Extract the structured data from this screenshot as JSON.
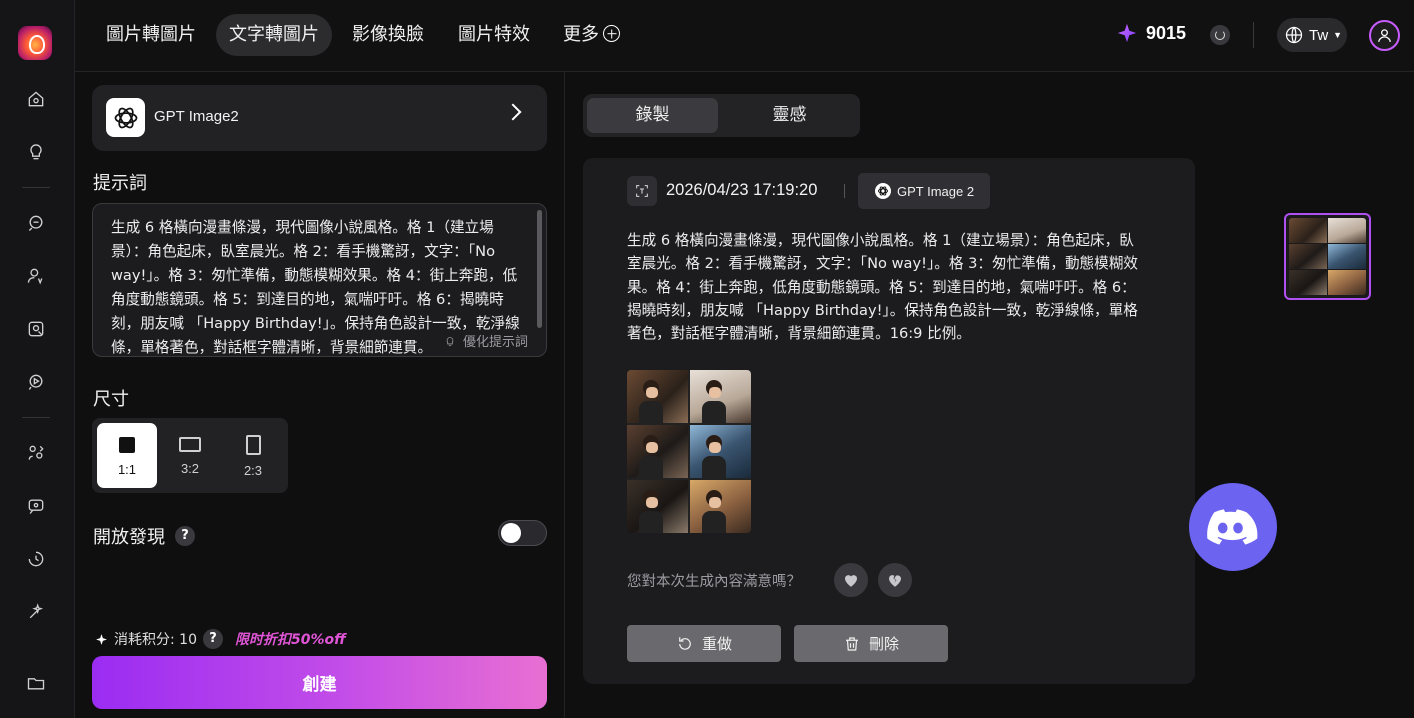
{
  "nav": {
    "tabs": [
      "圖片轉圖片",
      "文字轉圖片",
      "影像換臉",
      "圖片特效",
      "更多"
    ],
    "active_tab": "文字轉圖片",
    "credits": "9015",
    "language": "Tw"
  },
  "left_panel": {
    "model_name": "GPT Image2",
    "prompt_label": "提示詞",
    "prompt_text": "生成 6 格橫向漫畫條漫，現代圖像小說風格。格 1（建立場景）：角色起床，臥室晨光。格 2：看手機驚訝，文字：「No way!」。格 3：匆忙準備，動態模糊效果。格 4：街上奔跑，低角度動態鏡頭。格 5：到達目的地，氣喘吁吁。格 6：揭曉時刻，朋友喊 「Happy Birthday!」。保持角色設計一致，乾淨線條，單格著色，對話框字體清晰，背景細節連貫。",
    "optimize_label": "優化提示詞",
    "size_label": "尺寸",
    "sizes": [
      "1:1",
      "3:2",
      "2:3"
    ],
    "selected_size": "1:1",
    "discover_label": "開放發現",
    "help_mark": "?",
    "discover_enabled": false,
    "cost_label": "消耗积分: 10",
    "promo_label": "限时折扣50%off",
    "create_label": "創建"
  },
  "right_panel": {
    "segments": [
      "錄製",
      "靈感"
    ],
    "active_segment": "錄製",
    "record": {
      "timestamp": "2026/04/23 17:19:20",
      "model_chip": "GPT Image 2",
      "description": "生成 6 格橫向漫畫條漫，現代圖像小說風格。格 1（建立場景）：角色起床，臥室晨光。格 2：看手機驚訝，文字：「No way!」。格 3：匆忙準備，動態模糊效果。格 4：街上奔跑，低角度動態鏡頭。格 5：到達目的地，氣喘吁吁。格 6：揭曉時刻，朋友喊 「Happy Birthday!」。保持角色設計一致，乾淨線條，單格著色，對話框字體清晰，背景細節連貫。16:9 比例。",
      "satisfaction_question": "您對本次生成內容滿意嗎？",
      "redo_label": "重做",
      "delete_label": "刪除"
    }
  },
  "colors": {
    "accent_purple": "#b150f0",
    "create_gradient_start": "#9b2cf2",
    "create_gradient_end": "#e86fd2",
    "promo_pink": "#e055d6",
    "discord_blue": "#6c63f0"
  }
}
